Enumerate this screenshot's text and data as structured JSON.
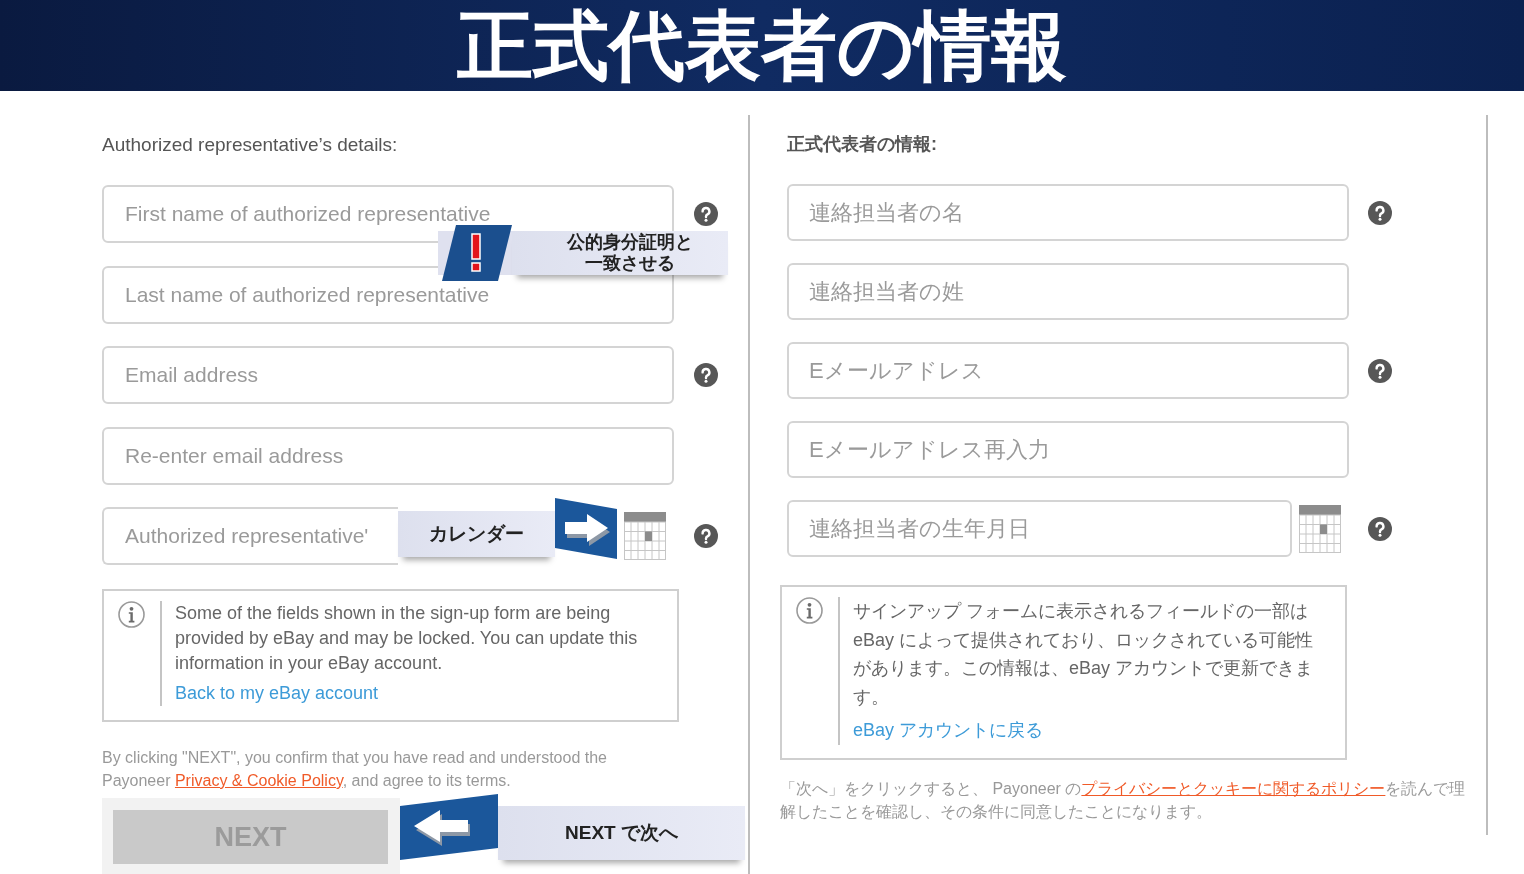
{
  "banner": {
    "title": "正式代表者の情報"
  },
  "panels": [
    {
      "heading": "Authorized representative’s details:",
      "fields": [
        {
          "kind": "text",
          "placeholder": "First name of authorized representative",
          "help": true,
          "callout": {
            "kind": "alert",
            "text": "公的身分証明と一致させる"
          }
        },
        {
          "kind": "text",
          "placeholder": "Last name of authorized representative",
          "help": false
        },
        {
          "kind": "text",
          "placeholder": "Email address",
          "help": true
        },
        {
          "kind": "text",
          "placeholder": "Re-enter email address",
          "help": false
        },
        {
          "kind": "date",
          "placeholder": "Authorized representative'",
          "help": true,
          "callout": {
            "kind": "pointer-right",
            "text": "カレンダー"
          }
        }
      ],
      "info": {
        "text": "Some of the fields shown in the sign-up form are being provided by eBay and may be locked. You can update this information in your eBay account.",
        "link": "Back to my eBay account"
      },
      "consent": {
        "before": "By clicking \"NEXT\", you confirm that you have read and understood the\nPayoneer ",
        "link": "Privacy & Cookie Policy",
        "after": ", and agree to its terms."
      },
      "button": {
        "label": "NEXT",
        "disabled": true,
        "callout": {
          "kind": "pointer-left",
          "text": "NEXT で次へ"
        }
      }
    },
    {
      "heading": "正式代表者の情報:",
      "fields": [
        {
          "kind": "text",
          "placeholder": "連絡担当者の名",
          "help": true
        },
        {
          "kind": "text",
          "placeholder": "連絡担当者の姓",
          "help": false
        },
        {
          "kind": "text",
          "placeholder": "Eメールアドレス",
          "help": true
        },
        {
          "kind": "text",
          "placeholder": "Eメールアドレス再入力",
          "help": false
        },
        {
          "kind": "date",
          "placeholder": "連絡担当者の生年月日",
          "help": true
        }
      ],
      "info": {
        "text": "サインアップ フォームに表示されるフィールドの一部はeBay によって提供されており、ロックされている可能性があります。この情報は、eBay アカウントで更新できます。",
        "link": "eBay アカウントに戻る"
      },
      "consent": {
        "before": "「次へ」をクリックすると、 Payoneer の",
        "link": "プライバシーとクッキーに関するポリシー",
        "after": "を読んで理解したことを確認し、その条件に同意したことになります。"
      }
    }
  ]
}
